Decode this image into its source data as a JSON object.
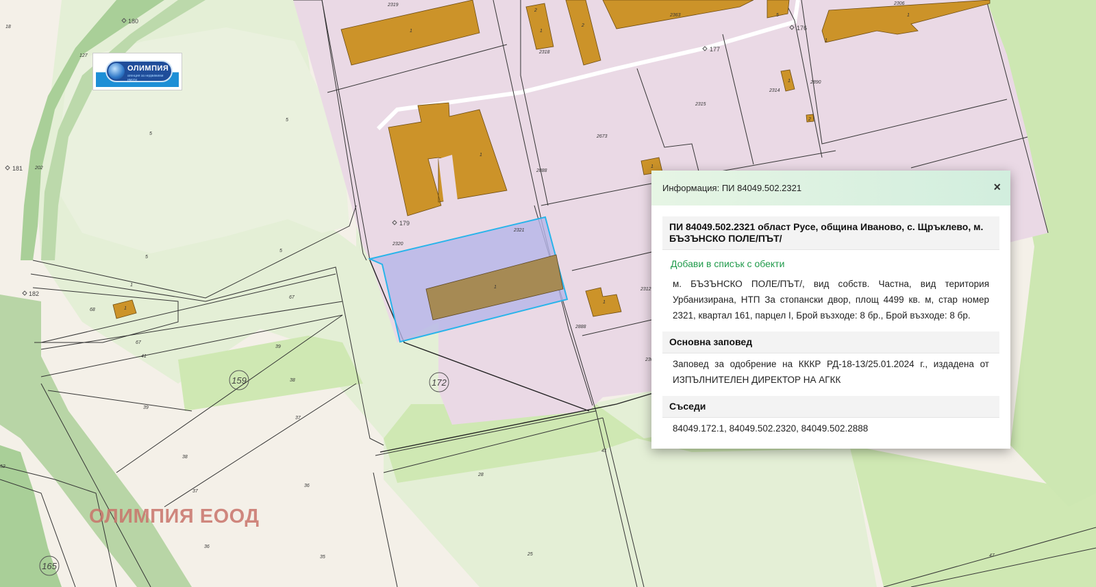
{
  "logo": {
    "name": "ОЛИМПИЯ",
    "subtitle": "агенция за недвижими имоти"
  },
  "watermark": "ОЛИМПИЯ ЕООД",
  "map": {
    "points": [
      "180",
      "181",
      "182",
      "179",
      "177",
      "176"
    ],
    "circled_blocks": [
      "159",
      "172",
      "165"
    ],
    "parcel_numbers": [
      "2319",
      "2318",
      "2363",
      "2306",
      "2314",
      "2890",
      "2315",
      "2673",
      "2888",
      "2320",
      "2321",
      "2312",
      "2888",
      "236",
      "127",
      "202",
      "18",
      "5",
      "5",
      "5",
      "5",
      "1",
      "68",
      "67",
      "67",
      "41",
      "39",
      "38",
      "39",
      "37",
      "38",
      "36",
      "37",
      "36",
      "35",
      "25",
      "28",
      "41",
      "47",
      "52"
    ],
    "building_labels": [
      "1",
      "1",
      "2",
      "2",
      "1",
      "5",
      "1",
      "2",
      "1",
      "1",
      "1",
      "1",
      "1",
      "1"
    ]
  },
  "popup": {
    "header_title": "Информация: ПИ 84049.502.2321",
    "close_symbol": "×",
    "object_title": "ПИ 84049.502.2321 област Русе, община Иваново, с. Щръклево, м. БЪЗЪНСКО ПОЛЕ/ПЪТ/",
    "add_link": "Добави в списък с обекти",
    "description": "м. БЪЗЪНСКО ПОЛЕ/ПЪТ/, вид собств. Частна, вид територия Урбанизирана, НТП За стопански двор, площ 4499 кв. м, стар номер 2321, квартал 161, парцел I, Брой възходе: 8 бр., Брой възходе: 8 бр.",
    "order_heading": "Основна заповед",
    "order_text": "Заповед за одобрение на КККР РД-18-13/25.01.2024 г., издадена от ИЗПЪЛНИТЕЛЕН ДИРЕКТОР НА АГКК",
    "neighbors_heading": "Съседи",
    "neighbors_text": "84049.172.1, 84049.502.2320, 84049.502.2888"
  },
  "colors": {
    "urban_pink": "#ead9e5",
    "building": "#cc9329",
    "selected_fill": "#b5b5e8",
    "selected_stroke": "#28b4ea",
    "green_light": "#cfe8b3",
    "forest": "#a9cf98",
    "link_green": "#1f9a4a"
  }
}
